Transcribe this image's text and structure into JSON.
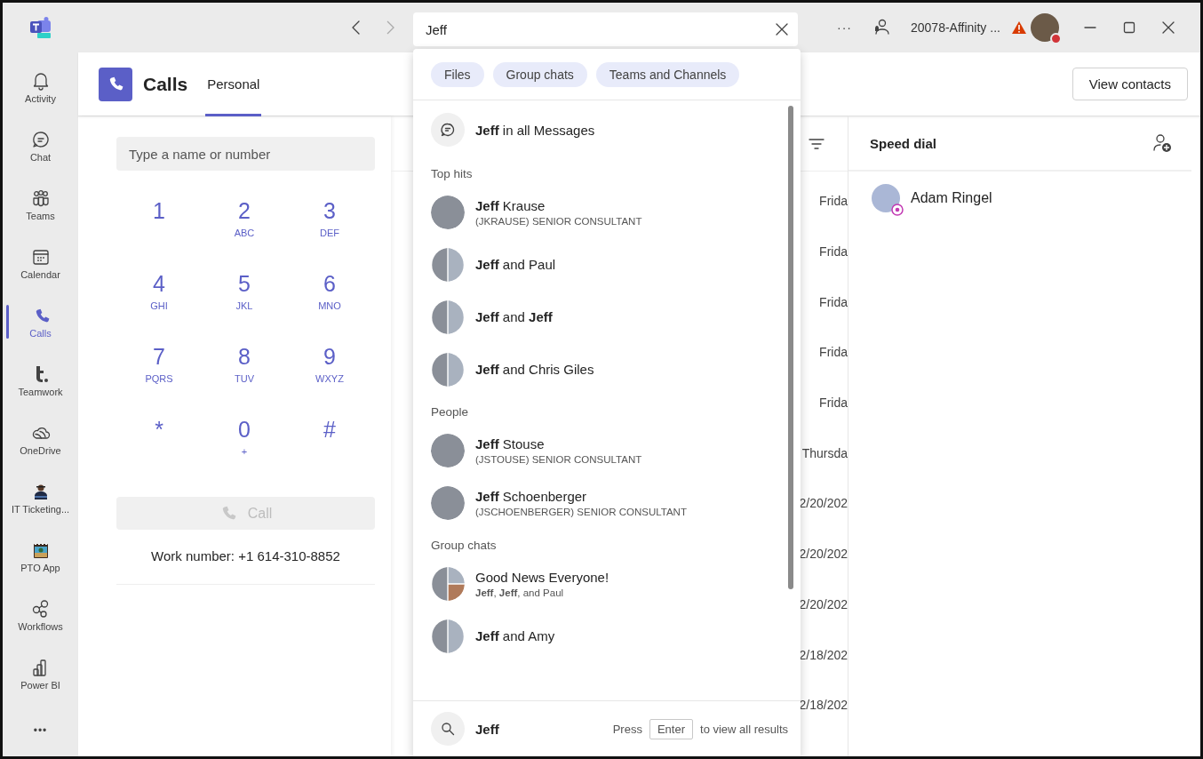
{
  "title_bar": {
    "search": {
      "value": "Jeff"
    },
    "more": "···",
    "org_name": "20078-Affinity ..."
  },
  "rail": [
    {
      "label": "Activity",
      "selected": false
    },
    {
      "label": "Chat",
      "selected": false
    },
    {
      "label": "Teams",
      "selected": false
    },
    {
      "label": "Calendar",
      "selected": false
    },
    {
      "label": "Calls",
      "selected": true
    },
    {
      "label": "Teamwork",
      "selected": false
    },
    {
      "label": "OneDrive",
      "selected": false
    },
    {
      "label": "IT Ticketing...",
      "selected": false
    },
    {
      "label": "PTO App",
      "selected": false
    },
    {
      "label": "Workflows",
      "selected": false
    },
    {
      "label": "Power BI",
      "selected": false
    }
  ],
  "rail_more": "•••",
  "header": {
    "title": "Calls",
    "tabs": [
      {
        "label": "Personal",
        "selected": true
      }
    ],
    "view_contacts": "View contacts"
  },
  "dialer": {
    "placeholder": "Type a name or number",
    "keys": [
      {
        "digit": "1"
      },
      {
        "digit": "2",
        "letters": "ABC"
      },
      {
        "digit": "3",
        "letters": "DEF"
      },
      {
        "digit": "4",
        "letters": "GHI"
      },
      {
        "digit": "5",
        "letters": "JKL"
      },
      {
        "digit": "6",
        "letters": "MNO"
      },
      {
        "digit": "7",
        "letters": "PQRS"
      },
      {
        "digit": "8",
        "letters": "TUV"
      },
      {
        "digit": "9",
        "letters": "WXYZ"
      },
      {
        "digit": "*"
      },
      {
        "digit": "0",
        "letters": "+"
      },
      {
        "digit": "#"
      }
    ],
    "call_button": {
      "label": "Call",
      "disabled": true
    },
    "work_number": "Work number: +1 614-310-8852"
  },
  "history": {
    "dates": [
      "Frida",
      "Frida",
      "Frida",
      "Frida",
      "Frida",
      "Thursda",
      "2/20/202",
      "2/20/202",
      "2/20/202",
      "2/18/202",
      "2/18/202"
    ]
  },
  "speed_dial": {
    "title": "Speed dial",
    "contacts": [
      {
        "name": "Adam Ringel"
      }
    ]
  },
  "search_dropdown": {
    "filters": [
      "Files",
      "Group chats",
      "Teams and Channels"
    ],
    "messages_hit": "**Jeff** in all Messages",
    "sections": [
      {
        "heading": "Top hits",
        "items": [
          {
            "kind": "person",
            "title": "**Jeff** Krause",
            "subtitle": "(JKRAUSE) SENIOR CONSULTANT"
          },
          {
            "kind": "pair",
            "title": "**Jeff** and Paul"
          },
          {
            "kind": "pair",
            "title": "**Jeff** and **Jeff**"
          },
          {
            "kind": "pair",
            "title": "**Jeff** and Chris Giles"
          }
        ]
      },
      {
        "heading": "People",
        "items": [
          {
            "kind": "person",
            "title": "**Jeff** Stouse",
            "subtitle": "(JSTOUSE) SENIOR CONSULTANT"
          },
          {
            "kind": "person",
            "title": "**Jeff** Schoenberger",
            "subtitle": "(JSCHOENBERGER) SENIOR CONSULTANT"
          }
        ]
      },
      {
        "heading": "Group chats",
        "items": [
          {
            "kind": "trio",
            "title": "Good News Everyone!",
            "subtitle": "**Jeff**, **Jeff**, and Paul"
          },
          {
            "kind": "pair",
            "title": "**Jeff** and Amy"
          }
        ]
      }
    ],
    "footer": {
      "query": "Jeff",
      "press": "Press",
      "key": "Enter",
      "hint": "to view all results"
    }
  }
}
